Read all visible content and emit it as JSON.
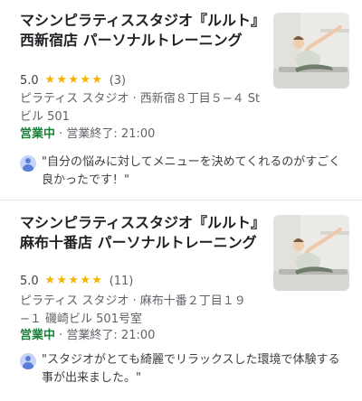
{
  "listings": [
    {
      "title": "マシンピラティススタジオ『ルルト』西新宿店 パーソナルトレーニング",
      "rating": "5.0",
      "stars": [
        "★",
        "★",
        "★",
        "★",
        "★"
      ],
      "review_count": "(3)",
      "category_address": "ピラティス スタジオ · 西新宿８丁目５−４ Stビル 501",
      "status": "営業中",
      "hours": "· 営業終了: 21:00",
      "review": "\"自分の悩みに対してメニューを決めてくれるのがすごく良かったです！\"",
      "icons": {
        "avatar": "user-avatar-icon",
        "photo": "studio-photo"
      },
      "colors": {
        "open": "#188038",
        "star": "#f4b400"
      }
    },
    {
      "title": "マシンピラティススタジオ『ルルト』麻布十番店 パーソナルトレーニング",
      "rating": "5.0",
      "stars": [
        "★",
        "★",
        "★",
        "★",
        "★"
      ],
      "review_count": "(11)",
      "category_address": "ピラティス スタジオ · 麻布十番２丁目１９−１ 磯崎ビル 501号室",
      "status": "営業中",
      "hours": "· 営業終了: 21:00",
      "review": "\"スタジオがとても綺麗でリラックスした環境で体験する事が出来ました。\"",
      "icons": {
        "avatar": "user-avatar-icon",
        "photo": "studio-photo"
      },
      "colors": {
        "open": "#188038",
        "star": "#f4b400"
      }
    }
  ]
}
